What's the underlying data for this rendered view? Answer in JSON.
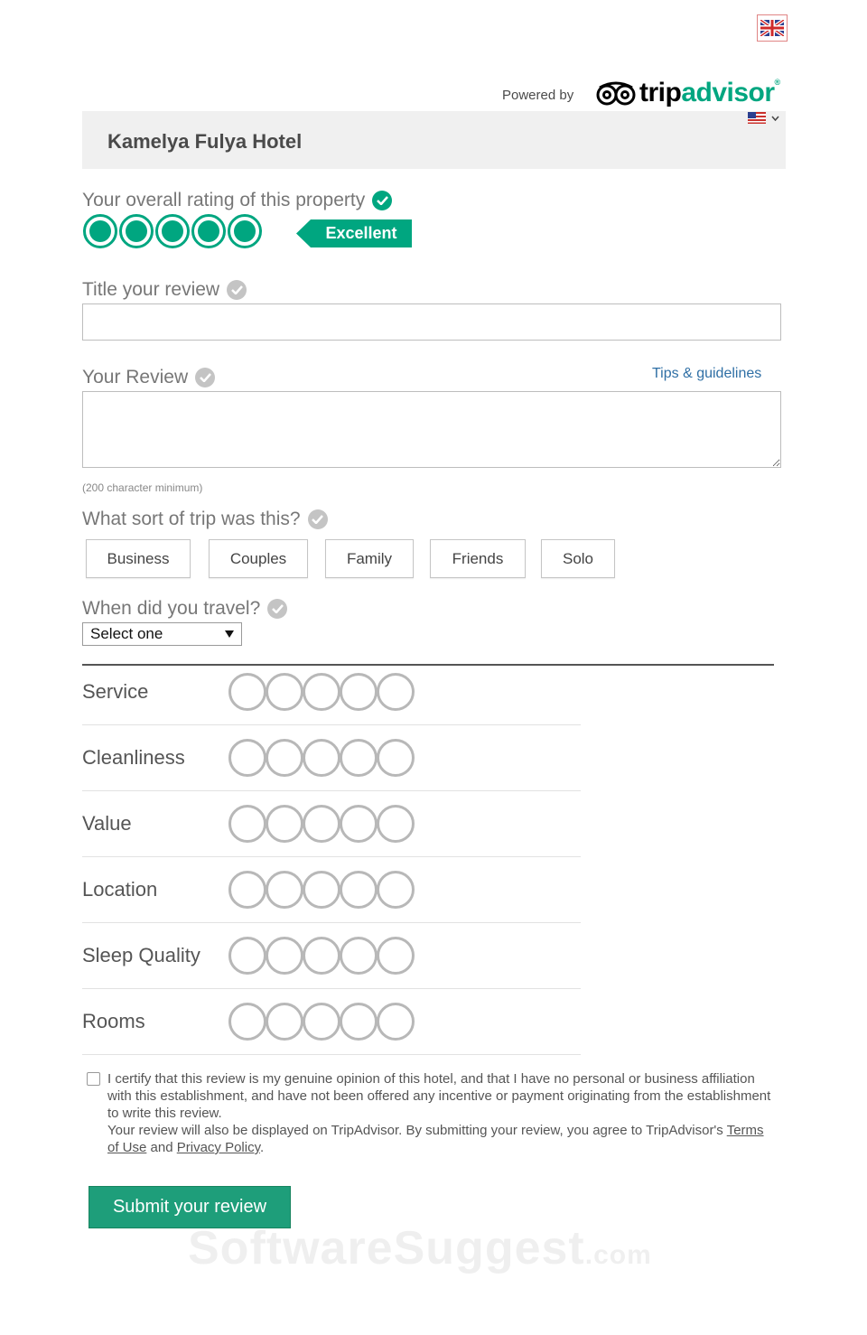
{
  "header": {
    "powered_by": "Powered by",
    "brand_part1": "trip",
    "brand_part2": "advisor",
    "brand_mark": "®",
    "language_flag": "uk-flag-icon",
    "locale_flag": "us-flag-icon"
  },
  "hotel": {
    "name": "Kamelya Fulya Hotel"
  },
  "overall": {
    "label": "Your overall rating of this property",
    "rating": 5,
    "max": 5,
    "tag": "Excellent"
  },
  "title_field": {
    "label": "Title your review",
    "value": ""
  },
  "review_field": {
    "label": "Your Review",
    "tips_link": "Tips & guidelines",
    "value": "",
    "minimum_note": "(200 character minimum)"
  },
  "trip_type": {
    "label": "What sort of trip was this?",
    "options": [
      "Business",
      "Couples",
      "Family",
      "Friends",
      "Solo"
    ]
  },
  "travel_date": {
    "label": "When did you travel?",
    "selected": "Select one"
  },
  "ratings": [
    {
      "name": "Service",
      "value": 0
    },
    {
      "name": "Cleanliness",
      "value": 0
    },
    {
      "name": "Value",
      "value": 0
    },
    {
      "name": "Location",
      "value": 0
    },
    {
      "name": "Sleep Quality",
      "value": 0
    },
    {
      "name": "Rooms",
      "value": 0
    }
  ],
  "certify": {
    "checked": false,
    "text_1": "I certify that this review is my genuine opinion of this hotel, and that I have no personal or business affiliation with this establishment, and have not been offered any incentive or payment originating from the establishment to write this review.",
    "text_2": "Your review will also be displayed on TripAdvisor. By submitting your review, you agree to TripAdvisor's",
    "terms_link": "Terms of Use",
    "and": "and",
    "privacy_link": "Privacy Policy",
    "end": "."
  },
  "submit_label": "Submit your review",
  "watermark": {
    "main": "SoftwareSuggest",
    "suffix": ".com"
  },
  "colors": {
    "brand_green": "#00a680",
    "submit_green": "#1e9e7a",
    "link_blue": "#2f6fa5"
  }
}
